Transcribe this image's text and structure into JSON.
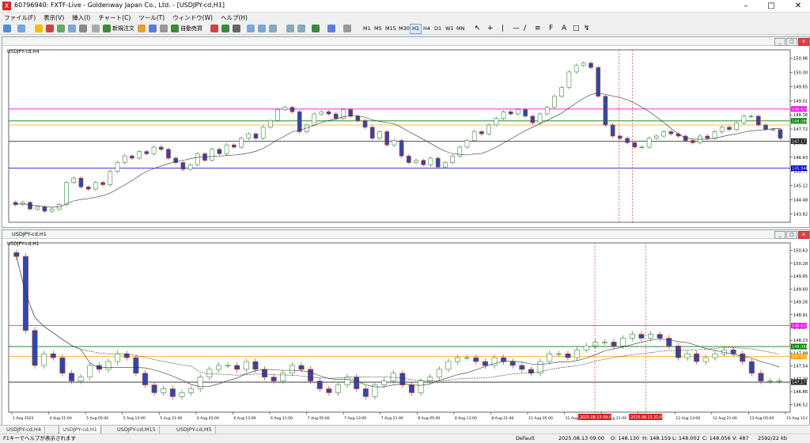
{
  "window": {
    "title": "60796940: FXTF-Live - Goldenway Japan Co., Ltd. - [USDJPY-cd,H1]",
    "app_icon_glyph": "X"
  },
  "menu": [
    "ファイル(F)",
    "表示(V)",
    "挿入(I)",
    "チャート(C)",
    "ツール(T)",
    "ウィンドウ(W)",
    "ヘルプ(H)"
  ],
  "toolbar": {
    "new_order": "新規注文",
    "auto_trade": "自動売買",
    "timeframes": [
      "M1",
      "M5",
      "M15",
      "M30",
      "H1",
      "H4",
      "D1",
      "W1",
      "MN"
    ],
    "active_timeframe": "H1",
    "text_tool": "A"
  },
  "chart_top": {
    "label": "USDJPY-cd,H4",
    "price_ticks": [
      "150.960",
      "150.300",
      "149.655",
      "149.010",
      "148.365",
      "147.720",
      "147.075",
      "146.430",
      "145.770",
      "145.125",
      "144.480",
      "143.820"
    ],
    "price_min": 143.5,
    "price_max": 151.3,
    "lines": [
      {
        "price": 148.624,
        "color": "#ff00ff",
        "label": "148.624"
      },
      {
        "price": 148.086,
        "color": "#008000",
        "label": "148.086"
      },
      {
        "price": 147.9,
        "color": "#ffa500",
        "label": ""
      },
      {
        "price": 147.171,
        "color": "#222222",
        "label": "147.171"
      },
      {
        "price": 145.946,
        "color": "#0000c0",
        "label": "145.946"
      }
    ],
    "candles": [
      144.3,
      144.4,
      144.1,
      144.2,
      144.0,
      144.1,
      144.3,
      145.3,
      145.5,
      145.1,
      145.0,
      145.3,
      145.2,
      145.8,
      146.2,
      146.5,
      146.4,
      146.7,
      146.6,
      146.9,
      146.8,
      146.4,
      146.2,
      145.9,
      146.1,
      146.6,
      146.3,
      146.8,
      146.6,
      147.0,
      146.9,
      147.3,
      147.5,
      147.3,
      147.8,
      148.1,
      148.6,
      148.7,
      148.5,
      147.6,
      147.9,
      148.4,
      148.5,
      148.4,
      148.2,
      148.6,
      148.3,
      148.1,
      147.8,
      147.3,
      147.6,
      147.0,
      147.2,
      146.5,
      146.2,
      146.3,
      146.1,
      146.4,
      146.0,
      146.2,
      146.5,
      146.9,
      147.2,
      147.6,
      147.5,
      147.9,
      148.2,
      148.5,
      148.4,
      148.6,
      148.3,
      148.0,
      148.4,
      148.7,
      149.2,
      149.6,
      150.3,
      150.6,
      150.7,
      150.5,
      149.2,
      147.9,
      147.4,
      147.3,
      147.1,
      146.9,
      146.9,
      147.3,
      147.4,
      147.6,
      147.5,
      147.4,
      147.2,
      147.1,
      147.4,
      147.3,
      147.6,
      147.8,
      147.7,
      148.0,
      148.3,
      148.3,
      147.9,
      147.7,
      147.7,
      147.3
    ]
  },
  "chart_bottom": {
    "label": "USDJPY-cd,H1",
    "price_ticks": [
      "150.630",
      "150.280",
      "149.950",
      "149.600",
      "149.260",
      "148.910",
      "148.570",
      "148.230",
      "147.890",
      "147.540",
      "147.200",
      "146.860",
      "146.520"
    ],
    "price_min": 146.4,
    "price_max": 150.75,
    "lines": [
      {
        "price": 148.624,
        "color": "#ff00ff",
        "label": "148.624"
      },
      {
        "price": 148.086,
        "color": "#008000",
        "label": "148.086"
      },
      {
        "price": 147.83,
        "color": "#ffa500",
        "label": "147.831"
      },
      {
        "price": 147.171,
        "color": "#222222",
        "label": "147.171"
      }
    ],
    "candles": [
      150.4,
      148.5,
      147.6,
      147.9,
      147.8,
      147.4,
      147.2,
      147.3,
      147.6,
      147.5,
      147.7,
      147.9,
      147.8,
      147.4,
      147.1,
      146.9,
      147.0,
      146.8,
      146.9,
      147.0,
      147.3,
      147.5,
      147.6,
      147.6,
      147.5,
      147.7,
      147.5,
      147.3,
      147.2,
      147.4,
      147.6,
      147.5,
      147.2,
      147.0,
      146.9,
      147.1,
      147.3,
      147.0,
      146.8,
      147.1,
      147.2,
      147.4,
      147.1,
      146.9,
      147.2,
      147.3,
      147.5,
      147.7,
      147.8,
      147.8,
      147.7,
      147.6,
      147.8,
      147.7,
      147.6,
      147.5,
      147.4,
      147.7,
      147.9,
      147.9,
      147.8,
      148.0,
      148.1,
      148.2,
      148.2,
      148.1,
      148.3,
      148.4,
      148.3,
      148.4,
      148.3,
      148.1,
      147.8,
      147.9,
      147.7,
      147.8,
      147.9,
      148.0,
      147.9,
      147.7,
      147.4,
      147.2,
      147.2,
      147.2
    ],
    "time_labels": [
      "1 Aug 2025",
      "4 Aug 21:00",
      "5 Aug 05:00",
      "5 Aug 13:00",
      "5 Aug 21:00",
      "6 Aug 05:00",
      "6 Aug 13:00",
      "6 Aug 21:00",
      "7 Aug 05:00",
      "7 Aug 13:00",
      "7 Aug 21:00",
      "8 Aug 05:00",
      "8 Aug 13:00",
      "8 Aug 21:00",
      "11 Aug 05:00",
      "11 Aug 13:00",
      "11 Aug 21:00",
      "12 Aug 05:00",
      "12 Aug 13:00",
      "12 Aug 21:00",
      "13 Aug 05:00",
      "13 Aug 13:00"
    ],
    "highlight_times": [
      "2025.08.13 09:00",
      "2025.08.13 21:00"
    ]
  },
  "tabs": [
    "USDJPY-cd,H4",
    "USDJPY-cd,H1",
    "USDJPY-cd,M15",
    "USDJPY-cd,M5"
  ],
  "active_tab": 1,
  "status": {
    "help": "F1キーでヘルプが表示されます",
    "profile": "Default",
    "time": "2025.08.13 09:00",
    "open": "O: 148.130",
    "high": "H: 148.159",
    "low": "L: 148.002",
    "close": "C: 148.056",
    "volume": "V: 487",
    "traffic": "2592/22 kb"
  },
  "colors": {
    "bull": "#3a8a3a",
    "bear": "#c0392b",
    "body_bull_fill": "#ffffff",
    "body_bear_fill": "#2b4aa8",
    "hilite": "#d62020"
  }
}
